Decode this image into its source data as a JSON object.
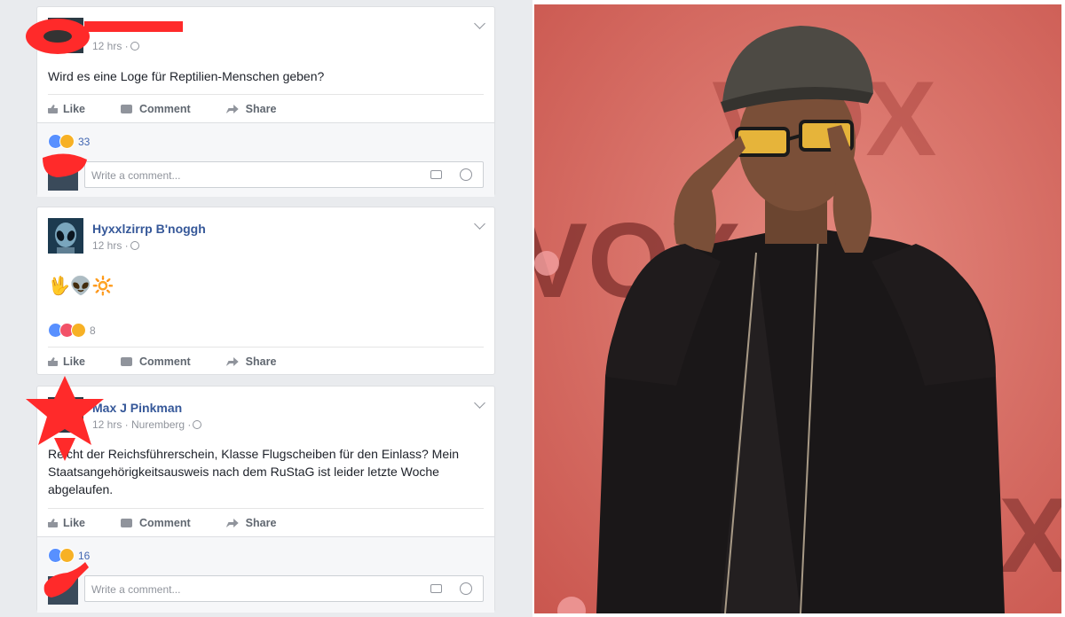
{
  "post1": {
    "time": "12 hrs ·",
    "text": "Wird es eine Loge für Reptilien-Menschen geben?",
    "actions": {
      "like": "Like",
      "comment": "Comment",
      "share": "Share"
    },
    "reaction_count": "33",
    "comment_placeholder": "Write a comment..."
  },
  "post2": {
    "author": "Hyxxlzirrp B'noggh",
    "time": "12 hrs ·",
    "emojis": "🖖👽🔆",
    "reaction_count": "8",
    "actions": {
      "like": "Like",
      "comment": "Comment",
      "share": "Share"
    }
  },
  "post3": {
    "author": "Max J Pinkman",
    "time": "12 hrs · Nuremberg ·",
    "text": "Reicht der Reichsführerschein, Klasse Flugscheiben für den Einlass? Mein Staatsangehörigkeitsausweis nach dem RuStaG ist leider letzte Woche abgelaufen.",
    "actions": {
      "like": "Like",
      "comment": "Comment",
      "share": "Share"
    },
    "reaction_count": "16",
    "comment_placeholder": "Write a comment..."
  },
  "colors": {
    "link": "#365899",
    "redaction": "#ff2a2a",
    "backdrop": "#d86b62"
  },
  "photo": {
    "backdrop_letters": "VOX"
  }
}
